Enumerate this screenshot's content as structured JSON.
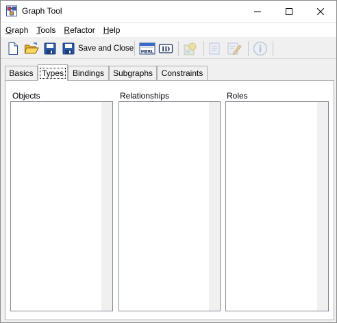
{
  "window": {
    "title": "Graph Tool",
    "icon": "graph-tool-app-icon"
  },
  "menu": [
    {
      "label": "Graph",
      "mnemonic_index": 0
    },
    {
      "label": "Tools",
      "mnemonic_index": 0
    },
    {
      "label": "Refactor",
      "mnemonic_index": 0
    },
    {
      "label": "Help",
      "mnemonic_index": 0
    }
  ],
  "toolbar": {
    "save_and_close_label": "Save and Close",
    "merl_label": "MERL",
    "id_label": "ID"
  },
  "tabs": [
    {
      "label": "Basics",
      "active": false
    },
    {
      "label": "Types",
      "active": true
    },
    {
      "label": "Bindings",
      "active": false
    },
    {
      "label": "Subgraphs",
      "active": false
    },
    {
      "label": "Constraints",
      "active": false
    }
  ],
  "panels": {
    "objects_label": "Objects",
    "relationships_label": "Relationships",
    "roles_label": "Roles"
  },
  "colors": {
    "window_bg": "#f0f0f0",
    "panel_bg": "#ffffff",
    "border": "#adadad"
  }
}
